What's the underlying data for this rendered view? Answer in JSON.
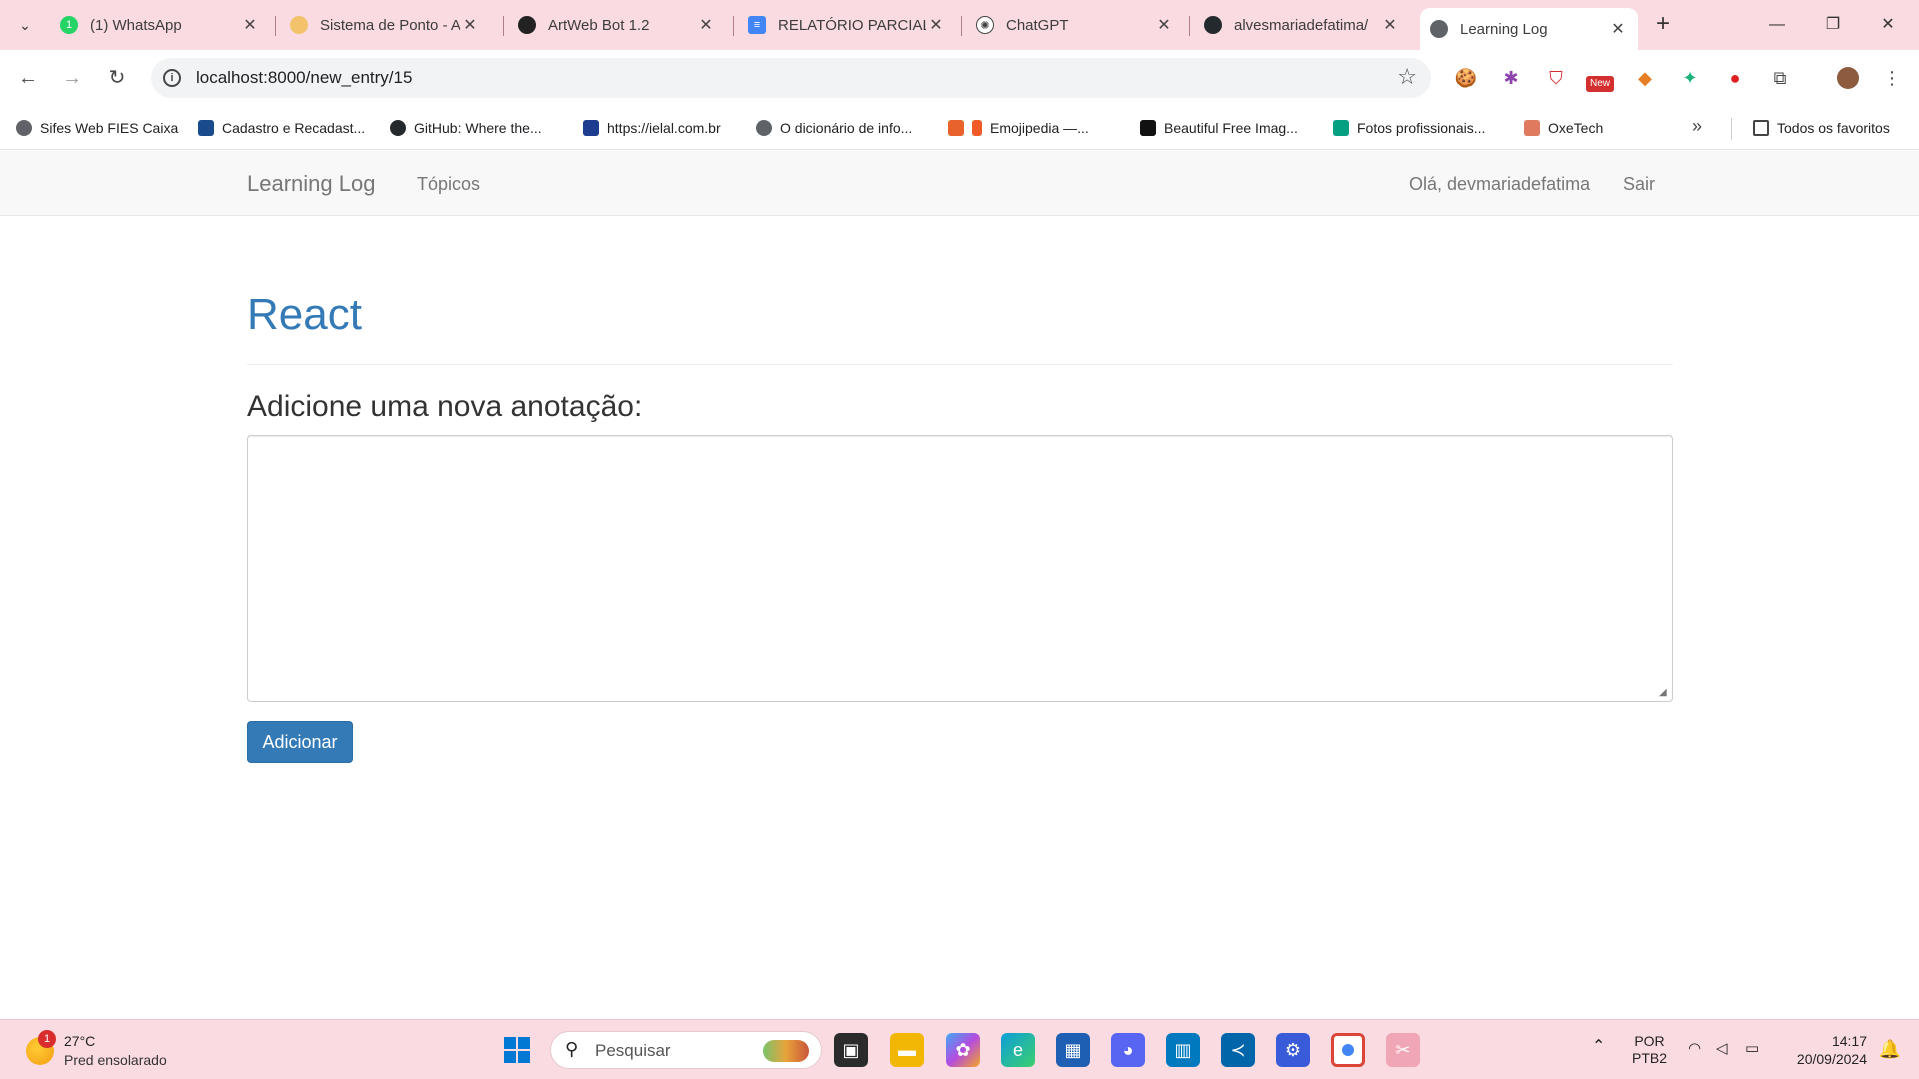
{
  "browser": {
    "tabs": [
      {
        "title": "(1) WhatsApp",
        "icon": "whatsapp-icon",
        "color": "#25d366"
      },
      {
        "title": "Sistema de Ponto - A",
        "icon": "hand-icon",
        "color": "#f2c36b"
      },
      {
        "title": "ArtWeb Bot 1.2",
        "icon": "artweb-icon",
        "color": "#222222"
      },
      {
        "title": "RELATÓRIO PARCIAL",
        "icon": "docs-icon",
        "color": "#4285f4"
      },
      {
        "title": "ChatGPT",
        "icon": "chatgpt-icon",
        "color": "#444444"
      },
      {
        "title": "alvesmariadefatima/",
        "icon": "github-icon",
        "color": "#24292e"
      },
      {
        "title": "Learning Log",
        "icon": "globe-icon",
        "color": "#5f6368"
      }
    ],
    "url": "localhost:8000/new_entry/15",
    "bookmarks": [
      {
        "label": "Sifes Web FIES Caixa",
        "icon": "globe-icon",
        "color": "#5f6368"
      },
      {
        "label": "Cadastro e Recadast...",
        "icon": "v-icon",
        "color": "#1a4b8c"
      },
      {
        "label": "GitHub: Where the...",
        "icon": "github-icon",
        "color": "#24292e"
      },
      {
        "label": "https://ielal.com.br",
        "icon": "ielal-icon",
        "color": "#1b3c8f"
      },
      {
        "label": "O dicionário de info...",
        "icon": "globe-icon",
        "color": "#5f6368"
      },
      {
        "label": "Emojipedia —...",
        "icon": "emojipedia-icon",
        "color": "#e8632c"
      },
      {
        "label": "Beautiful Free Imag...",
        "icon": "unsplash-icon",
        "color": "#111111"
      },
      {
        "label": "Fotos profissionais...",
        "icon": "pexels-icon",
        "color": "#05a081"
      },
      {
        "label": "OxeTech",
        "icon": "oxetech-icon",
        "color": "#e07a5f"
      }
    ],
    "all_bookmarks_label": "Todos os favoritos"
  },
  "navbar": {
    "brand": "Learning Log",
    "topics": "Tópicos",
    "greeting": "Olá, devmariadefatima",
    "logout": "Sair"
  },
  "main": {
    "topic_title": "React",
    "form_label": "Adicione uma nova anotação:",
    "textarea_value": "",
    "submit_label": "Adicionar"
  },
  "colors": {
    "link": "#337ab7",
    "tab_strip": "#f9dbe1"
  },
  "taskbar": {
    "weather_temp": "27°C",
    "weather_desc": "Pred ensolarado",
    "weather_badge": "1",
    "search_placeholder": "Pesquisar",
    "lang_top": "POR",
    "lang_bottom": "PTB2",
    "time": "14:17",
    "date": "20/09/2024"
  }
}
